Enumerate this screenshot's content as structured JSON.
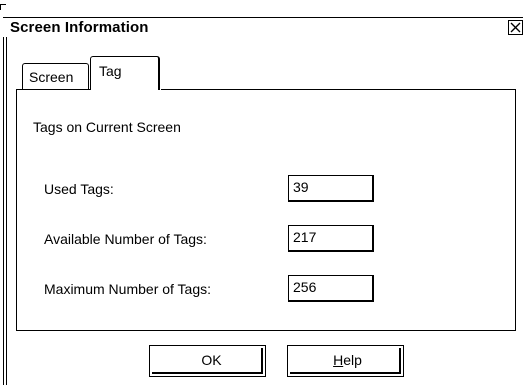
{
  "window": {
    "title": "Screen Information",
    "close_glyph": "✕"
  },
  "tabs": [
    {
      "label": "Screen",
      "active": false
    },
    {
      "label": "Tag",
      "active": true
    }
  ],
  "panel": {
    "section_title": "Tags on Current Screen",
    "rows": [
      {
        "label": "Used Tags:",
        "value": "39"
      },
      {
        "label": "Available Number of Tags:",
        "value": "217"
      },
      {
        "label": "Maximum Number of Tags:",
        "value": "256"
      }
    ]
  },
  "buttons": {
    "ok_label": "OK",
    "help_mnemonic": "H",
    "help_rest": "elp"
  },
  "icons": {
    "close": "close-icon"
  }
}
